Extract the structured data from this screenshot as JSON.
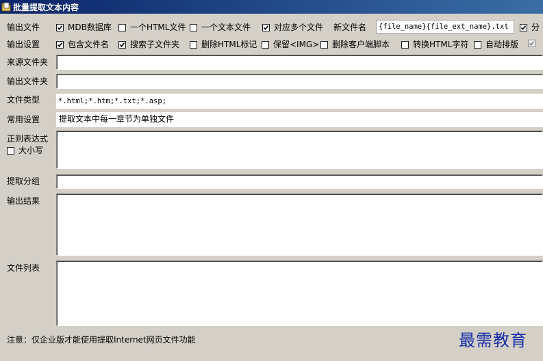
{
  "window": {
    "title": "批量提取文本内容"
  },
  "output_file": {
    "label": "输出文件",
    "options": [
      {
        "label": "MDB数据库",
        "checked": true
      },
      {
        "label": "一个HTML文件",
        "checked": false
      },
      {
        "label": "一个文本文件",
        "checked": false
      },
      {
        "label": "对应多个文件",
        "checked": true
      }
    ],
    "new_filename_label": "新文件名",
    "new_filename_value": "{file_name}{file_ext_name}.txt",
    "split_label": "分",
    "split_checked": true
  },
  "output_settings": {
    "label": "输出设置",
    "options": [
      {
        "label": "包含文件名",
        "checked": true
      },
      {
        "label": "搜索子文件夹",
        "checked": true
      },
      {
        "label": "删除HTML标记",
        "checked": false
      },
      {
        "label": "保留<IMG>",
        "checked": false
      },
      {
        "label": "删除客户端脚本",
        "checked": false
      },
      {
        "label": "转换HTML字符",
        "checked": false
      },
      {
        "label": "自动排版",
        "checked": false
      }
    ],
    "extra_checked": true
  },
  "source_folder": {
    "label": "来源文件夹",
    "value": ""
  },
  "output_folder": {
    "label": "输出文件夹",
    "value": ""
  },
  "file_types": {
    "label": "文件类型",
    "value": "*.html;*.htm;*.txt;*.asp;"
  },
  "common_settings": {
    "label": "常用设置",
    "value": "提取文本中每一章节为单独文件"
  },
  "regex": {
    "label": "正则表达式",
    "case_label": "大小写",
    "case_checked": false,
    "value": ""
  },
  "extract_group": {
    "label": "提取分组",
    "value": ""
  },
  "output_result": {
    "label": "输出结果",
    "value": ""
  },
  "file_list": {
    "label": "文件列表",
    "value": ""
  },
  "footer": {
    "note": "注意：仅企业版才能使用提取Internet网页文件功能"
  },
  "watermark": {
    "text": "最需教育"
  },
  "colors": {
    "face": "#d4d0c8",
    "title_start": "#0a246a",
    "title_end": "#3a6ea5",
    "watermark": "#1a2fa8"
  }
}
